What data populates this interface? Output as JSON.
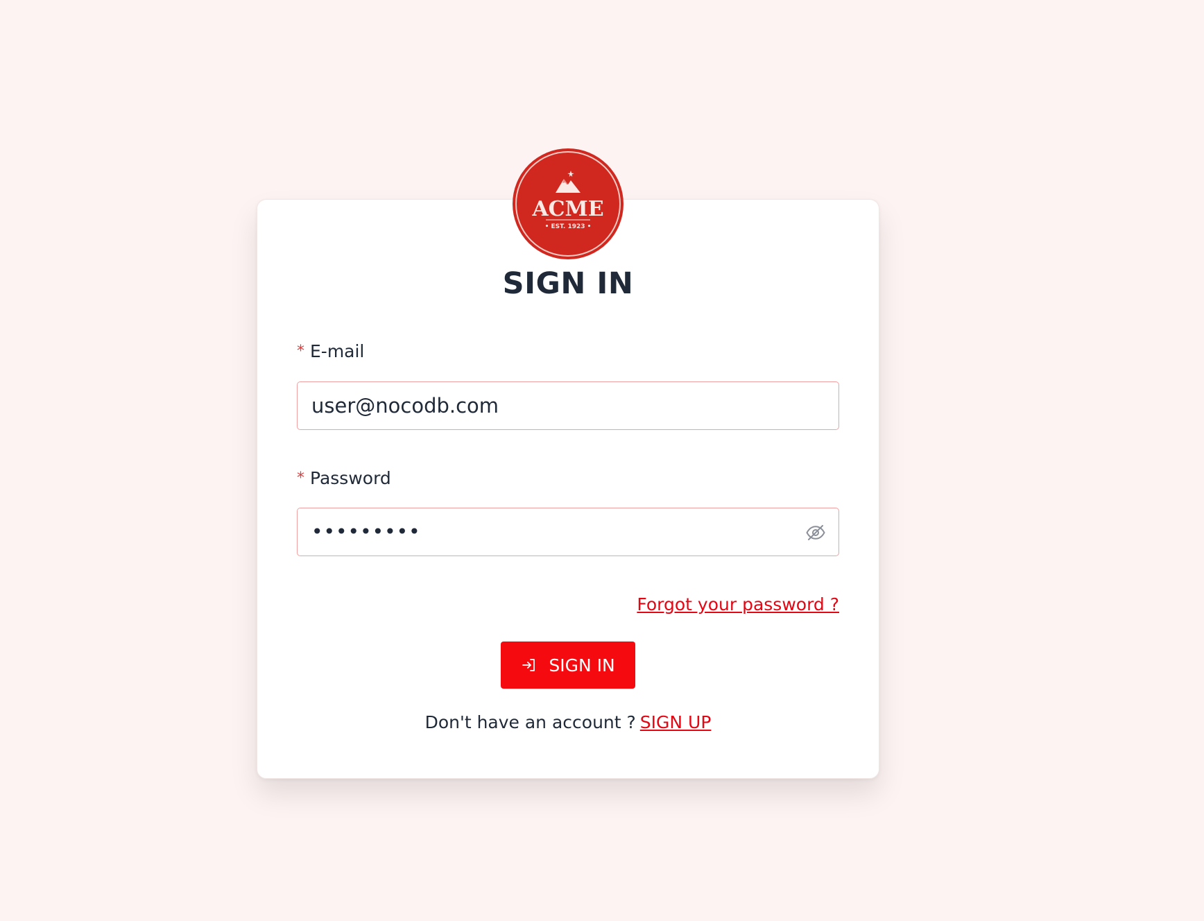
{
  "logo": {
    "brand": "ACME",
    "established": "• EST. 1923 •",
    "color": "#d0281f"
  },
  "page_title": "SIGN IN",
  "form": {
    "email": {
      "label": "E-mail",
      "required_mark": "*",
      "value": "user@nocodb.com"
    },
    "password": {
      "label": "Password",
      "required_mark": "*",
      "masked_value": "•••••••••",
      "toggle_icon": "eye-off-icon"
    },
    "forgot_link": "Forgot your password ?",
    "submit_label": "SIGN IN",
    "submit_icon": "login-icon"
  },
  "signup": {
    "prompt": "Don't have an account ?",
    "link": "SIGN UP"
  },
  "colors": {
    "accent": "#f50a10",
    "link": "#e30613",
    "background": "#fdf3f2",
    "input_border": "#f0a0a0"
  }
}
